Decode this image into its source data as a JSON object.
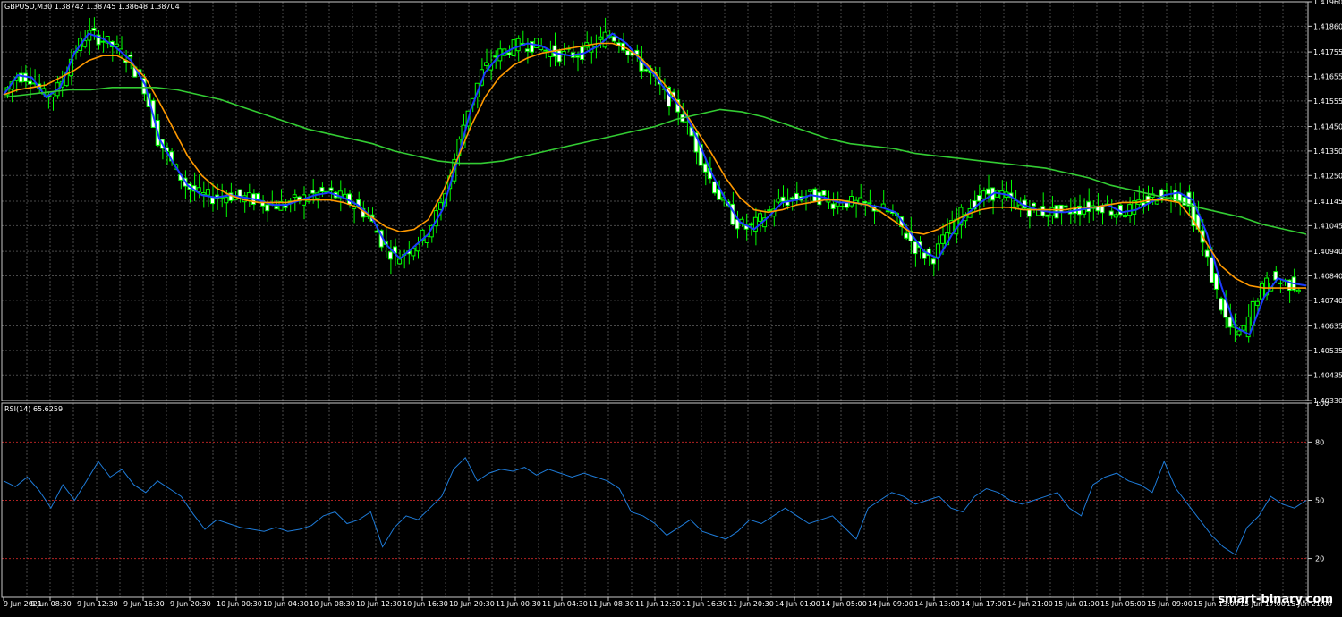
{
  "header": {
    "symbol_info": "GBPUSD,M30  1.38742 1.38745 1.38648 1.38704",
    "rsi_info": "RSI(14) 65.6259"
  },
  "watermark": "smart-binary.com",
  "colors": {
    "background": "#000000",
    "grid": "#4a4a4a",
    "frame": "#c8c8c8",
    "bull_candle": "#00ff00",
    "bear_candle": "#ffffff",
    "fast_ma": "#1c3cff",
    "mid_ma": "#ff9900",
    "slow_ma": "#33cc33",
    "rsi_line": "#1e7bd8",
    "rsi_level": "#b22222"
  },
  "chart_data": [
    {
      "type": "line",
      "title": "GBPUSD,M30",
      "x_tick_labels": [
        "9 Jun 2021",
        "9 Jun 08:30",
        "9 Jun 12:30",
        "9 Jun 16:30",
        "9 Jun 20:30",
        "10 Jun 00:30",
        "10 Jun 04:30",
        "10 Jun 08:30",
        "10 Jun 12:30",
        "10 Jun 16:30",
        "10 Jun 20:30",
        "11 Jun 00:30",
        "11 Jun 04:30",
        "11 Jun 08:30",
        "11 Jun 12:30",
        "11 Jun 16:30",
        "11 Jun 20:30",
        "14 Jun 01:00",
        "14 Jun 05:00",
        "14 Jun 09:00",
        "14 Jun 13:00",
        "14 Jun 17:00",
        "14 Jun 21:00",
        "15 Jun 01:00",
        "15 Jun 05:00",
        "15 Jun 09:00",
        "15 Jun 13:00",
        "15 Jun 17:00",
        "15 Jun 21:00"
      ],
      "y_tick_labels": [
        "1.41960",
        "1.41860",
        "1.41755",
        "1.41655",
        "1.41555",
        "1.41450",
        "1.41350",
        "1.41250",
        "1.41145",
        "1.41045",
        "1.40940",
        "1.40840",
        "1.40740",
        "1.40635",
        "1.40535",
        "1.40435",
        "1.40330"
      ],
      "ylim": [
        1.4033,
        1.4196
      ],
      "series": [
        {
          "name": "",
          "role": "fast",
          "values": [
            1.4158,
            1.4166,
            1.4165,
            1.4157,
            1.4161,
            1.4175,
            1.4183,
            1.4181,
            1.4177,
            1.4172,
            1.4162,
            1.414,
            1.413,
            1.4121,
            1.4117,
            1.4116,
            1.4117,
            1.4116,
            1.4115,
            1.4113,
            1.4113,
            1.4115,
            1.4117,
            1.4118,
            1.4116,
            1.4113,
            1.4108,
            1.4097,
            1.4091,
            1.4096,
            1.4101,
            1.4111,
            1.413,
            1.4152,
            1.4167,
            1.4174,
            1.4177,
            1.4179,
            1.4178,
            1.4175,
            1.4174,
            1.4175,
            1.4178,
            1.4183,
            1.4179,
            1.4172,
            1.4166,
            1.4158,
            1.4152,
            1.414,
            1.4126,
            1.4115,
            1.4106,
            1.4103,
            1.4108,
            1.4114,
            1.4115,
            1.4117,
            1.4116,
            1.4114,
            1.4114,
            1.4113,
            1.4112,
            1.411,
            1.4102,
            1.4094,
            1.4091,
            1.4101,
            1.4109,
            1.4114,
            1.4118,
            1.4117,
            1.4113,
            1.4111,
            1.411,
            1.411,
            1.4111,
            1.4112,
            1.4113,
            1.411,
            1.4111,
            1.4114,
            1.4117,
            1.4118,
            1.4115,
            1.4101,
            1.408,
            1.4063,
            1.406,
            1.4075,
            1.4083,
            1.4081,
            1.408
          ]
        },
        {
          "name": "",
          "role": "mid",
          "values": [
            1.4158,
            1.416,
            1.4161,
            1.4162,
            1.4165,
            1.4168,
            1.4172,
            1.4174,
            1.4174,
            1.4171,
            1.4165,
            1.4155,
            1.4144,
            1.4133,
            1.4125,
            1.412,
            1.4117,
            1.4115,
            1.4114,
            1.4114,
            1.4114,
            1.4115,
            1.4115,
            1.4115,
            1.4114,
            1.4112,
            1.4108,
            1.4104,
            1.4102,
            1.4103,
            1.4107,
            1.4118,
            1.4131,
            1.4145,
            1.4157,
            1.4165,
            1.417,
            1.4173,
            1.4175,
            1.4176,
            1.4177,
            1.4178,
            1.4179,
            1.4179,
            1.4177,
            1.4173,
            1.4167,
            1.416,
            1.4152,
            1.4143,
            1.4134,
            1.4124,
            1.4116,
            1.4111,
            1.411,
            1.4111,
            1.4113,
            1.4114,
            1.4115,
            1.4115,
            1.4114,
            1.4113,
            1.411,
            1.4106,
            1.4102,
            1.4101,
            1.4103,
            1.4106,
            1.4109,
            1.4111,
            1.4112,
            1.4112,
            1.4111,
            1.4111,
            1.4111,
            1.4111,
            1.4112,
            1.4112,
            1.4113,
            1.4114,
            1.4114,
            1.4115,
            1.4115,
            1.4114,
            1.4107,
            1.4097,
            1.4088,
            1.4083,
            1.408,
            1.4079,
            1.4079,
            1.4079,
            1.4079
          ]
        },
        {
          "name": "",
          "role": "slow",
          "values": [
            1.4157,
            1.4158,
            1.4159,
            1.416,
            1.416,
            1.4161,
            1.4161,
            1.4161,
            1.416,
            1.4158,
            1.4156,
            1.4153,
            1.415,
            1.4147,
            1.4144,
            1.4142,
            1.414,
            1.4138,
            1.4135,
            1.4133,
            1.4131,
            1.413,
            1.413,
            1.4131,
            1.4133,
            1.4135,
            1.4137,
            1.4139,
            1.4141,
            1.4143,
            1.4145,
            1.4148,
            1.415,
            1.4152,
            1.4151,
            1.4149,
            1.4146,
            1.4143,
            1.414,
            1.4138,
            1.4137,
            1.4136,
            1.4134,
            1.4133,
            1.4132,
            1.4131,
            1.413,
            1.4129,
            1.4128,
            1.4126,
            1.4124,
            1.4121,
            1.4119,
            1.4117,
            1.4115,
            1.4112,
            1.411,
            1.4108,
            1.4105,
            1.4103,
            1.4101
          ]
        }
      ]
    },
    {
      "type": "line",
      "title": "RSI(14)",
      "y_tick_labels": [
        "100",
        "80",
        "50",
        "20"
      ],
      "levels": [
        80,
        50,
        20
      ],
      "ylim": [
        0,
        100
      ],
      "series": [
        {
          "name": "RSI(14)",
          "values": [
            60,
            57,
            62,
            55,
            46,
            58,
            50,
            60,
            70,
            62,
            66,
            58,
            54,
            60,
            56,
            52,
            43,
            35,
            40,
            38,
            36,
            35,
            34,
            36,
            34,
            35,
            37,
            42,
            44,
            38,
            40,
            44,
            26,
            36,
            42,
            40,
            46,
            52,
            66,
            72,
            60,
            64,
            66,
            65,
            67,
            63,
            66,
            64,
            62,
            64,
            62,
            60,
            56,
            44,
            42,
            38,
            32,
            36,
            40,
            34,
            32,
            30,
            34,
            40,
            38,
            42,
            46,
            42,
            38,
            40,
            42,
            36,
            30,
            46,
            50,
            54,
            52,
            48,
            50,
            52,
            46,
            44,
            52,
            56,
            54,
            50,
            48,
            50,
            52,
            54,
            46,
            42,
            58,
            62,
            64,
            60,
            58,
            54,
            70,
            56,
            48,
            40,
            32,
            26,
            22,
            36,
            42,
            52,
            48,
            46,
            50
          ]
        }
      ]
    }
  ]
}
